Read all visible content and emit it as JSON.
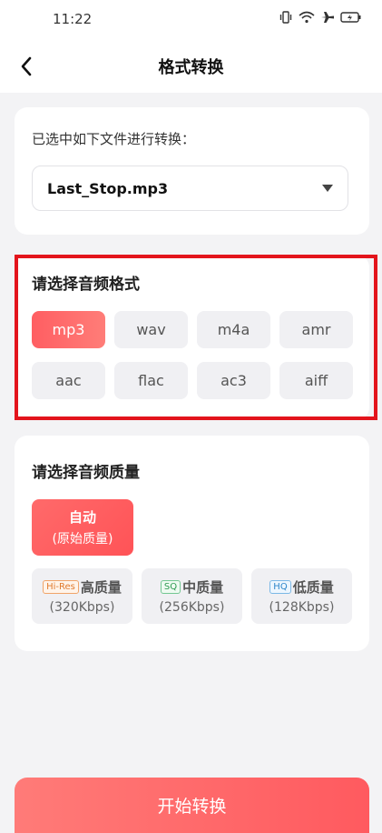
{
  "status_bar": {
    "time": "11:22"
  },
  "header": {
    "title": "格式转换"
  },
  "file_card": {
    "label": "已选中如下文件进行转换：",
    "selected_file": "Last_Stop.mp3"
  },
  "format_card": {
    "title": "请选择音频格式",
    "selected": "mp3",
    "options": [
      "mp3",
      "wav",
      "m4a",
      "amr",
      "aac",
      "flac",
      "ac3",
      "aiff"
    ]
  },
  "quality_card": {
    "title": "请选择音频质量",
    "auto": {
      "line1": "自动",
      "line2": "(原始质量)"
    },
    "options": [
      {
        "badge": "Hi-Res",
        "name": "高质量",
        "rate": "(320Kbps)"
      },
      {
        "badge": "SQ",
        "name": "中质量",
        "rate": "(256Kbps)"
      },
      {
        "badge": "HQ",
        "name": "低质量",
        "rate": "(128Kbps)"
      }
    ]
  },
  "start_button": {
    "label": "开始转换"
  },
  "colors": {
    "accent": "#ff5e62",
    "highlight_border": "#e3141c",
    "background": "#f3f3f5"
  }
}
